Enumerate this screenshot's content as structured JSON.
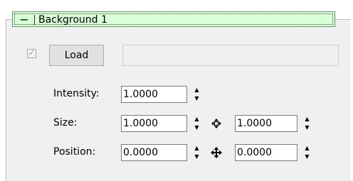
{
  "panel": {
    "title": "Background 1",
    "collapse_symbol": "−",
    "checkbox_mark": "✓",
    "load_label": "Load"
  },
  "fields": {
    "intensity": {
      "label": "Intensity:",
      "value": "1.0000"
    },
    "size": {
      "label": "Size:",
      "value_x": "1.0000",
      "value_y": "1.0000"
    },
    "position": {
      "label": "Position:",
      "value_x": "0.0000",
      "value_y": "0.0000"
    }
  },
  "icons": {
    "spin_up": "▲",
    "spin_down": "▼",
    "size_link": "resize-arrows-icon",
    "position_link": "move-arrows-icon"
  },
  "colors": {
    "header_bg": "#d8ffd8",
    "header_border": "#6a8f6a",
    "panel_bg": "#f0f0f0"
  }
}
